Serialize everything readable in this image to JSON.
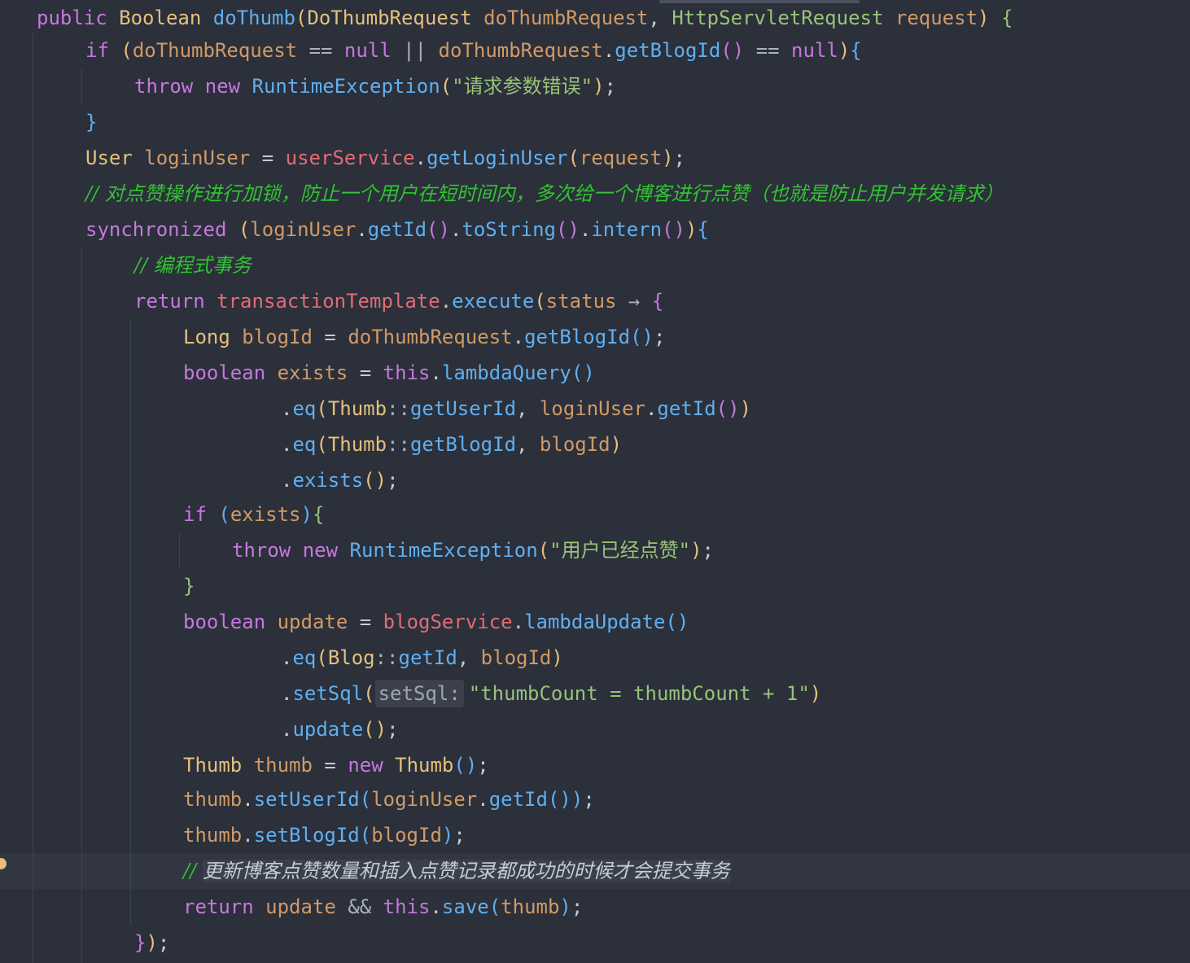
{
  "editor": {
    "lines": [
      {
        "tokens": [
          {
            "c": "kw",
            "t": "public"
          },
          {
            "c": "plain",
            "t": " "
          },
          {
            "c": "type",
            "t": "Boolean"
          },
          {
            "c": "plain",
            "t": " "
          },
          {
            "c": "fn",
            "t": "doThumb"
          },
          {
            "c": "p1",
            "t": "("
          },
          {
            "c": "type",
            "t": "DoThumbRequest"
          },
          {
            "c": "plain",
            "t": " "
          },
          {
            "c": "param",
            "t": "doThumbRequest"
          },
          {
            "c": "plain",
            "t": ", "
          },
          {
            "c": "str",
            "t": "HttpServletRequest"
          },
          {
            "c": "plain",
            "t": " "
          },
          {
            "c": "param",
            "t": "request"
          },
          {
            "c": "p1",
            "t": ")"
          },
          {
            "c": "plain",
            "t": " "
          },
          {
            "c": "str",
            "t": "{"
          }
        ]
      },
      {
        "tokens": [
          {
            "c": "kw",
            "t": "if"
          },
          {
            "c": "plain",
            "t": " "
          },
          {
            "c": "p1",
            "t": "("
          },
          {
            "c": "param",
            "t": "doThumbRequest"
          },
          {
            "c": "plain",
            "t": " "
          },
          {
            "c": "op",
            "t": "=="
          },
          {
            "c": "plain",
            "t": " "
          },
          {
            "c": "kw",
            "t": "null"
          },
          {
            "c": "plain",
            "t": " "
          },
          {
            "c": "op",
            "t": "||"
          },
          {
            "c": "plain",
            "t": " "
          },
          {
            "c": "param",
            "t": "doThumbRequest"
          },
          {
            "c": "plain",
            "t": "."
          },
          {
            "c": "fn",
            "t": "getBlogId"
          },
          {
            "c": "p2",
            "t": "()"
          },
          {
            "c": "plain",
            "t": " "
          },
          {
            "c": "op",
            "t": "=="
          },
          {
            "c": "plain",
            "t": " "
          },
          {
            "c": "kw",
            "t": "null"
          },
          {
            "c": "p1",
            "t": ")"
          },
          {
            "c": "p3",
            "t": "{"
          }
        ]
      },
      {
        "tokens": [
          {
            "c": "kw",
            "t": "throw"
          },
          {
            "c": "plain",
            "t": " "
          },
          {
            "c": "kw",
            "t": "new"
          },
          {
            "c": "plain",
            "t": " "
          },
          {
            "c": "fn",
            "t": "RuntimeException"
          },
          {
            "c": "p1",
            "t": "("
          },
          {
            "c": "str",
            "t": "\"请求参数错误\""
          },
          {
            "c": "p1",
            "t": ")"
          },
          {
            "c": "plain",
            "t": ";"
          }
        ]
      },
      {
        "tokens": [
          {
            "c": "p3",
            "t": "}"
          }
        ]
      },
      {
        "tokens": [
          {
            "c": "type",
            "t": "User"
          },
          {
            "c": "plain",
            "t": " "
          },
          {
            "c": "param",
            "t": "loginUser"
          },
          {
            "c": "plain",
            "t": " = "
          },
          {
            "c": "var",
            "t": "userService"
          },
          {
            "c": "plain",
            "t": "."
          },
          {
            "c": "fn",
            "t": "getLoginUser"
          },
          {
            "c": "p1",
            "t": "("
          },
          {
            "c": "param",
            "t": "request"
          },
          {
            "c": "p1",
            "t": ")"
          },
          {
            "c": "plain",
            "t": ";"
          }
        ]
      },
      {
        "tokens": [
          {
            "c": "cmt",
            "t": "// 对点赞操作进行加锁，防止一个用户在短时间内，多次给一个博客进行点赞（也就是防止用户并发请求）"
          }
        ]
      },
      {
        "tokens": [
          {
            "c": "kw",
            "t": "synchronized"
          },
          {
            "c": "plain",
            "t": " "
          },
          {
            "c": "p1",
            "t": "("
          },
          {
            "c": "param",
            "t": "loginUser"
          },
          {
            "c": "plain",
            "t": "."
          },
          {
            "c": "fn",
            "t": "getId"
          },
          {
            "c": "p2",
            "t": "()"
          },
          {
            "c": "plain",
            "t": "."
          },
          {
            "c": "fn",
            "t": "toString"
          },
          {
            "c": "p2",
            "t": "()"
          },
          {
            "c": "plain",
            "t": "."
          },
          {
            "c": "fn",
            "t": "intern"
          },
          {
            "c": "p2",
            "t": "()"
          },
          {
            "c": "p1",
            "t": ")"
          },
          {
            "c": "p3",
            "t": "{"
          }
        ]
      },
      {
        "tokens": [
          {
            "c": "cmt",
            "t": "// 编程式事务"
          }
        ]
      },
      {
        "tokens": [
          {
            "c": "kw",
            "t": "return"
          },
          {
            "c": "plain",
            "t": " "
          },
          {
            "c": "var",
            "t": "transactionTemplate"
          },
          {
            "c": "plain",
            "t": "."
          },
          {
            "c": "fn",
            "t": "execute"
          },
          {
            "c": "p1",
            "t": "("
          },
          {
            "c": "param",
            "t": "status"
          },
          {
            "c": "plain",
            "t": " "
          },
          {
            "c": "op",
            "t": "→"
          },
          {
            "c": "plain",
            "t": " "
          },
          {
            "c": "p2",
            "t": "{"
          }
        ]
      },
      {
        "tokens": [
          {
            "c": "type",
            "t": "Long"
          },
          {
            "c": "plain",
            "t": " "
          },
          {
            "c": "param",
            "t": "blogId"
          },
          {
            "c": "plain",
            "t": " = "
          },
          {
            "c": "param",
            "t": "doThumbRequest"
          },
          {
            "c": "plain",
            "t": "."
          },
          {
            "c": "fn",
            "t": "getBlogId"
          },
          {
            "c": "p3",
            "t": "()"
          },
          {
            "c": "plain",
            "t": ";"
          }
        ]
      },
      {
        "tokens": [
          {
            "c": "kw",
            "t": "boolean"
          },
          {
            "c": "plain",
            "t": " "
          },
          {
            "c": "param",
            "t": "exists"
          },
          {
            "c": "plain",
            "t": " = "
          },
          {
            "c": "kw",
            "t": "this"
          },
          {
            "c": "plain",
            "t": "."
          },
          {
            "c": "fn",
            "t": "lambdaQuery"
          },
          {
            "c": "p3",
            "t": "()"
          }
        ]
      },
      {
        "tokens": [
          {
            "c": "plain",
            "t": "."
          },
          {
            "c": "fn",
            "t": "eq"
          },
          {
            "c": "p1",
            "t": "("
          },
          {
            "c": "type",
            "t": "Thumb"
          },
          {
            "c": "op",
            "t": "::"
          },
          {
            "c": "fn",
            "t": "getUserId"
          },
          {
            "c": "plain",
            "t": ", "
          },
          {
            "c": "param",
            "t": "loginUser"
          },
          {
            "c": "plain",
            "t": "."
          },
          {
            "c": "fn",
            "t": "getId"
          },
          {
            "c": "p2",
            "t": "()"
          },
          {
            "c": "p1",
            "t": ")"
          }
        ]
      },
      {
        "tokens": [
          {
            "c": "plain",
            "t": "."
          },
          {
            "c": "fn",
            "t": "eq"
          },
          {
            "c": "p1",
            "t": "("
          },
          {
            "c": "type",
            "t": "Thumb"
          },
          {
            "c": "op",
            "t": "::"
          },
          {
            "c": "fn",
            "t": "getBlogId"
          },
          {
            "c": "plain",
            "t": ", "
          },
          {
            "c": "param",
            "t": "blogId"
          },
          {
            "c": "p1",
            "t": ")"
          }
        ]
      },
      {
        "tokens": [
          {
            "c": "plain",
            "t": "."
          },
          {
            "c": "fn",
            "t": "exists"
          },
          {
            "c": "p1",
            "t": "()"
          },
          {
            "c": "plain",
            "t": ";"
          }
        ]
      },
      {
        "tokens": [
          {
            "c": "kw",
            "t": "if"
          },
          {
            "c": "plain",
            "t": " "
          },
          {
            "c": "p3",
            "t": "("
          },
          {
            "c": "param",
            "t": "exists"
          },
          {
            "c": "p3",
            "t": ")"
          },
          {
            "c": "str",
            "t": "{"
          }
        ]
      },
      {
        "tokens": [
          {
            "c": "kw",
            "t": "throw"
          },
          {
            "c": "plain",
            "t": " "
          },
          {
            "c": "kw",
            "t": "new"
          },
          {
            "c": "plain",
            "t": " "
          },
          {
            "c": "fn",
            "t": "RuntimeException"
          },
          {
            "c": "p1",
            "t": "("
          },
          {
            "c": "str",
            "t": "\"用户已经点赞\""
          },
          {
            "c": "p1",
            "t": ")"
          },
          {
            "c": "plain",
            "t": ";"
          }
        ]
      },
      {
        "tokens": [
          {
            "c": "str",
            "t": "}"
          }
        ]
      },
      {
        "tokens": [
          {
            "c": "kw",
            "t": "boolean"
          },
          {
            "c": "plain",
            "t": " "
          },
          {
            "c": "param",
            "t": "update"
          },
          {
            "c": "plain",
            "t": " = "
          },
          {
            "c": "var",
            "t": "blogService"
          },
          {
            "c": "plain",
            "t": "."
          },
          {
            "c": "fn",
            "t": "lambdaUpdate"
          },
          {
            "c": "p3",
            "t": "()"
          }
        ]
      },
      {
        "tokens": [
          {
            "c": "plain",
            "t": "."
          },
          {
            "c": "fn",
            "t": "eq"
          },
          {
            "c": "p1",
            "t": "("
          },
          {
            "c": "type",
            "t": "Blog"
          },
          {
            "c": "op",
            "t": "::"
          },
          {
            "c": "fn",
            "t": "getId"
          },
          {
            "c": "plain",
            "t": ", "
          },
          {
            "c": "param",
            "t": "blogId"
          },
          {
            "c": "p1",
            "t": ")"
          }
        ]
      },
      {
        "tokens": [
          {
            "c": "plain",
            "t": "."
          },
          {
            "c": "fn",
            "t": "setSql"
          },
          {
            "c": "p1",
            "t": "("
          },
          {
            "c": "hint",
            "t": "setSql:"
          },
          {
            "c": "str",
            "t": "\"thumbCount = thumbCount + 1\""
          },
          {
            "c": "p1",
            "t": ")"
          }
        ]
      },
      {
        "tokens": [
          {
            "c": "plain",
            "t": "."
          },
          {
            "c": "fn",
            "t": "update"
          },
          {
            "c": "p1",
            "t": "()"
          },
          {
            "c": "plain",
            "t": ";"
          }
        ]
      },
      {
        "tokens": [
          {
            "c": "type",
            "t": "Thumb"
          },
          {
            "c": "plain",
            "t": " "
          },
          {
            "c": "param",
            "t": "thumb"
          },
          {
            "c": "plain",
            "t": " = "
          },
          {
            "c": "kw",
            "t": "new"
          },
          {
            "c": "plain",
            "t": " "
          },
          {
            "c": "type",
            "t": "Thumb"
          },
          {
            "c": "p3",
            "t": "()"
          },
          {
            "c": "plain",
            "t": ";"
          }
        ]
      },
      {
        "tokens": [
          {
            "c": "param",
            "t": "thumb"
          },
          {
            "c": "plain",
            "t": "."
          },
          {
            "c": "fn",
            "t": "setUserId"
          },
          {
            "c": "p3",
            "t": "("
          },
          {
            "c": "param",
            "t": "loginUser"
          },
          {
            "c": "plain",
            "t": "."
          },
          {
            "c": "fn",
            "t": "getId"
          },
          {
            "c": "p3",
            "t": "()"
          },
          {
            "c": "p3",
            "t": ")"
          },
          {
            "c": "plain",
            "t": ";"
          }
        ]
      },
      {
        "tokens": [
          {
            "c": "param",
            "t": "thumb"
          },
          {
            "c": "plain",
            "t": "."
          },
          {
            "c": "fn",
            "t": "setBlogId"
          },
          {
            "c": "p3",
            "t": "("
          },
          {
            "c": "param",
            "t": "blogId"
          },
          {
            "c": "p3",
            "t": ")"
          },
          {
            "c": "plain",
            "t": ";"
          }
        ]
      },
      {
        "tokens": [
          {
            "c": "cmt",
            "t": "// "
          },
          {
            "c": "cmt-sel",
            "t": "更新博客点赞数量和插入点赞记录都成功的时候才会提交事务"
          }
        ]
      },
      {
        "tokens": [
          {
            "c": "kw",
            "t": "return"
          },
          {
            "c": "plain",
            "t": " "
          },
          {
            "c": "param",
            "t": "update"
          },
          {
            "c": "plain",
            "t": " "
          },
          {
            "c": "op",
            "t": "&&"
          },
          {
            "c": "plain",
            "t": " "
          },
          {
            "c": "kw",
            "t": "this"
          },
          {
            "c": "plain",
            "t": "."
          },
          {
            "c": "fn",
            "t": "save"
          },
          {
            "c": "p3",
            "t": "("
          },
          {
            "c": "param",
            "t": "thumb"
          },
          {
            "c": "p3",
            "t": ")"
          },
          {
            "c": "plain",
            "t": ";"
          }
        ]
      },
      {
        "tokens": [
          {
            "c": "p2",
            "t": "}"
          },
          {
            "c": "p1",
            "t": ")"
          },
          {
            "c": "plain",
            "t": ";"
          }
        ]
      }
    ]
  }
}
